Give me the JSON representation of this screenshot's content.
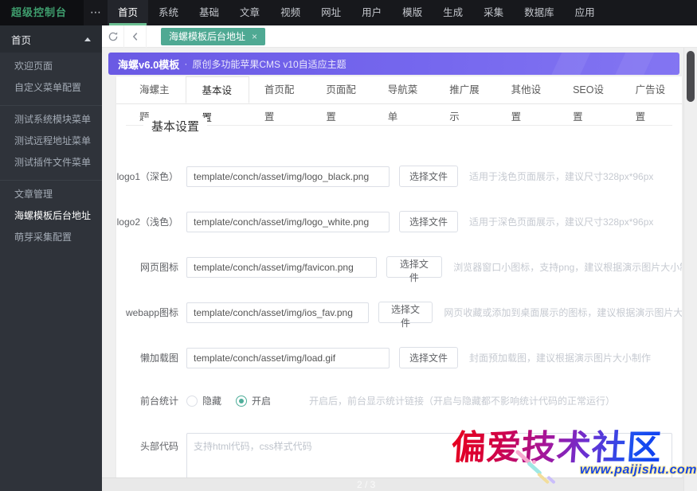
{
  "navbar": {
    "logo": "超级控制台",
    "more_icon": "⋯",
    "items": [
      "首页",
      "系统",
      "基础",
      "文章",
      "视频",
      "网址",
      "用户",
      "模版",
      "生成",
      "采集",
      "数据库",
      "应用"
    ],
    "active": "首页"
  },
  "tabbar": {
    "active_tab": "海螺模板后台地址",
    "close_icon": "×"
  },
  "banner": {
    "title": "海螺v6.0模板",
    "separator": "·",
    "subtitle": "原创多功能苹果CMS v10自适应主题"
  },
  "sidebar": {
    "header": "首页",
    "groups": [
      [
        "欢迎页面",
        "自定义菜单配置"
      ],
      [
        "测试系统模块菜单",
        "测试远程地址菜单",
        "测试插件文件菜单"
      ],
      [
        "文章管理",
        "海螺模板后台地址",
        "萌芽采集配置"
      ]
    ],
    "active": "海螺模板后台地址"
  },
  "tabs": [
    "海螺主题",
    "基本设置",
    "首页配置",
    "页面配置",
    "导航菜单",
    "推广展示",
    "其他设置",
    "SEO设置",
    "广告设置"
  ],
  "active_tab": "基本设置",
  "form": {
    "section_title": "基本设置",
    "choose_file": "选择文件",
    "rows": [
      {
        "label": "logo1（深色）",
        "value": "template/conch/asset/img/logo_black.png",
        "hint": "适用于浅色页面展示，建议尺寸328px*96px"
      },
      {
        "label": "logo2（浅色）",
        "value": "template/conch/asset/img/logo_white.png",
        "hint": "适用于深色页面展示，建议尺寸328px*96px"
      },
      {
        "label": "网页图标",
        "value": "template/conch/asset/img/favicon.png",
        "hint": "浏览器窗口小图标，支持png，建议根据演示图片大小制作"
      },
      {
        "label": "webapp图标",
        "value": "template/conch/asset/img/ios_fav.png",
        "hint": "网页收藏或添加到桌面展示的图标，建议根据演示图片大小制作"
      },
      {
        "label": "懒加载图",
        "value": "template/conch/asset/img/load.gif",
        "hint": "封面预加载图，建议根据演示图片大小制作"
      }
    ],
    "stats": {
      "label": "前台统计",
      "option_hide": "隐藏",
      "option_on": "开启",
      "selected": "开启",
      "hint": "开启后，前台显示统计链接（开启与隐藏都不影响统计代码的正常运行）"
    },
    "head_code": {
      "label": "头部代码",
      "placeholder": "支持html代码，css样式代码"
    }
  },
  "footer": {
    "pagination": "2 / 3"
  },
  "watermark": {
    "title": "偏爱技术社区",
    "url": "www.paijishu.com"
  },
  "icons": {
    "refresh": "circular-refresh-arrow",
    "back": "chevron-left",
    "close": "×",
    "collapse": "triangle-up",
    "more": "⋯"
  },
  "colors": {
    "accent_green": "#5fb878",
    "tab_teal": "#4fa993",
    "banner_purple": "#6c5ce7",
    "navbar_bg": "#17181c",
    "sidebar_bg": "#2f333a"
  }
}
